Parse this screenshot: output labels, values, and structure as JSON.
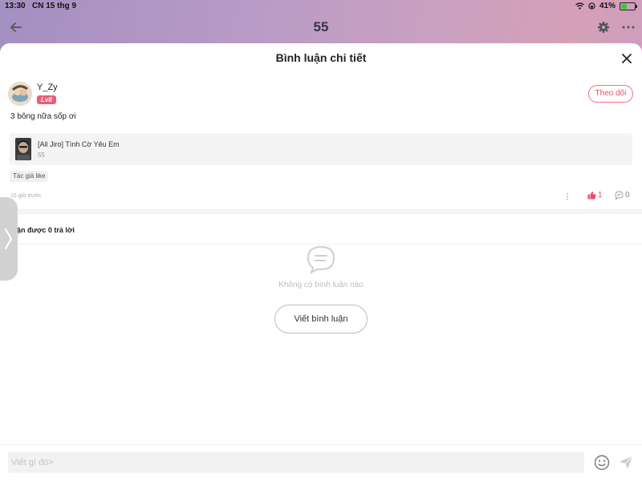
{
  "status_bar": {
    "time": "13:30",
    "date": "CN 15 thg 9",
    "battery": "41%",
    "battery_level": 0.41
  },
  "top_nav": {
    "title": "55"
  },
  "sheet": {
    "title": "Bình luận chi tiết"
  },
  "comment": {
    "username": "Y_Zy",
    "level": "Lv8",
    "follow_label": "Theo dõi",
    "text": "3 bông nữa sốp ơi",
    "story": {
      "title": "[All Jiro] Tình Cờ Yêu Em",
      "subtitle": "55"
    },
    "author_like_tag": "Tác giả like",
    "timestamp": "15 giờ trước",
    "like_count": "1",
    "reply_count": "0"
  },
  "replies": {
    "count_label": "Nhận được 0 trả lời",
    "empty_text": "Không có bình luận nào",
    "write_button": "Viết bình luận"
  },
  "composer": {
    "placeholder": "Viết gì đó>"
  },
  "colors": {
    "accent": "#ea4d6a",
    "level_badge": "#ef5a74",
    "muted": "#bdbdbd"
  },
  "icons": [
    "back-arrow-icon",
    "gear-icon",
    "more-horizontal-icon",
    "close-icon",
    "more-vertical-icon",
    "thumbs-up-icon",
    "comment-bubble-icon",
    "chat-empty-icon",
    "emoji-icon",
    "send-icon",
    "chevron-right-icon",
    "wifi-icon",
    "lock-rotation-icon",
    "battery-icon"
  ]
}
